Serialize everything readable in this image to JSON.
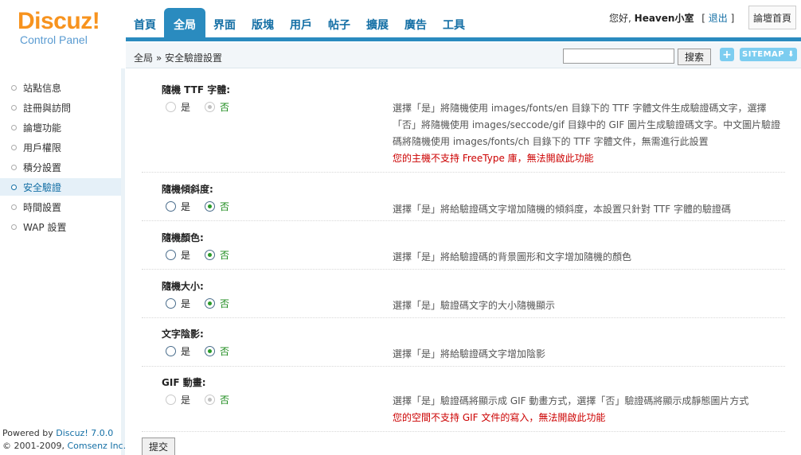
{
  "logo": {
    "brand": "Discuz!",
    "subtitle": "Control Panel"
  },
  "nav": {
    "tabs": [
      "首頁",
      "全局",
      "界面",
      "版塊",
      "用戶",
      "帖子",
      "擴展",
      "廣告",
      "工具"
    ],
    "active_index": 1
  },
  "user": {
    "greeting": "您好,",
    "name": "Heaven小室",
    "bracket_open": "[",
    "logout": "退出",
    "bracket_close": "]",
    "forum_home": "論壇首頁"
  },
  "breadcrumb": {
    "text": "全局 » 安全驗證設置"
  },
  "search": {
    "value": "",
    "button": "搜索"
  },
  "toolbar": {
    "plus": "+",
    "sitemap": "SITEMAP ⬇"
  },
  "sidebar": {
    "items": [
      "站點信息",
      "註冊與訪問",
      "論壇功能",
      "用戶權限",
      "積分設置",
      "安全驗證",
      "時間設置",
      "WAP 設置"
    ],
    "active_index": 5
  },
  "footer": {
    "powered_prefix": "Powered by ",
    "powered_link": "Discuz! 7.0.0",
    "copyright_prefix": "© 2001-2009, ",
    "copyright_link": "Comsenz Inc."
  },
  "settings": [
    {
      "title": "隨機 TTF 字體:",
      "yes": "是",
      "no": "否",
      "selected": "no",
      "disabled": true,
      "desc": "選擇「是」將隨機使用 images/fonts/en 目錄下的 TTF 字體文件生成驗證碼文字，選擇「否」將隨機使用 images/seccode/gif 目錄中的 GIF 圖片生成驗證碼文字。中文圖片驗證碼將隨機使用 images/fonts/ch 目錄下的 TTF 字體文件，無需進行此設置",
      "warning": "您的主機不支持 FreeType 庫，無法開啟此功能"
    },
    {
      "title": "隨機傾斜度:",
      "yes": "是",
      "no": "否",
      "selected": "no",
      "disabled": false,
      "desc": "選擇「是」將給驗證碼文字增加隨機的傾斜度，本設置只針對 TTF 字體的驗證碼",
      "warning": ""
    },
    {
      "title": "隨機顏色:",
      "yes": "是",
      "no": "否",
      "selected": "no",
      "disabled": false,
      "desc": "選擇「是」將給驗證碼的背景圖形和文字增加隨機的顏色",
      "warning": ""
    },
    {
      "title": "隨機大小:",
      "yes": "是",
      "no": "否",
      "selected": "no",
      "disabled": false,
      "desc": "選擇「是」驗證碼文字的大小隨機顯示",
      "warning": ""
    },
    {
      "title": "文字陰影:",
      "yes": "是",
      "no": "否",
      "selected": "no",
      "disabled": false,
      "desc": "選擇「是」將給驗證碼文字增加陰影",
      "warning": ""
    },
    {
      "title": "GIF 動畫:",
      "yes": "是",
      "no": "否",
      "selected": "no",
      "disabled": true,
      "desc": "選擇「是」驗證碼將顯示成 GIF 動畫方式，選擇「否」驗證碼將顯示成靜態圖片方式",
      "warning": "您的空間不支持 GIF 文件的寫入，無法開啟此功能"
    }
  ],
  "submit": {
    "label": "提交"
  },
  "colors": {
    "accent": "#2a8bbf",
    "nav_text": "#146fa5",
    "logo": "#f7931e",
    "warning": "#cc0000",
    "selected_green": "#1a8a1a"
  }
}
